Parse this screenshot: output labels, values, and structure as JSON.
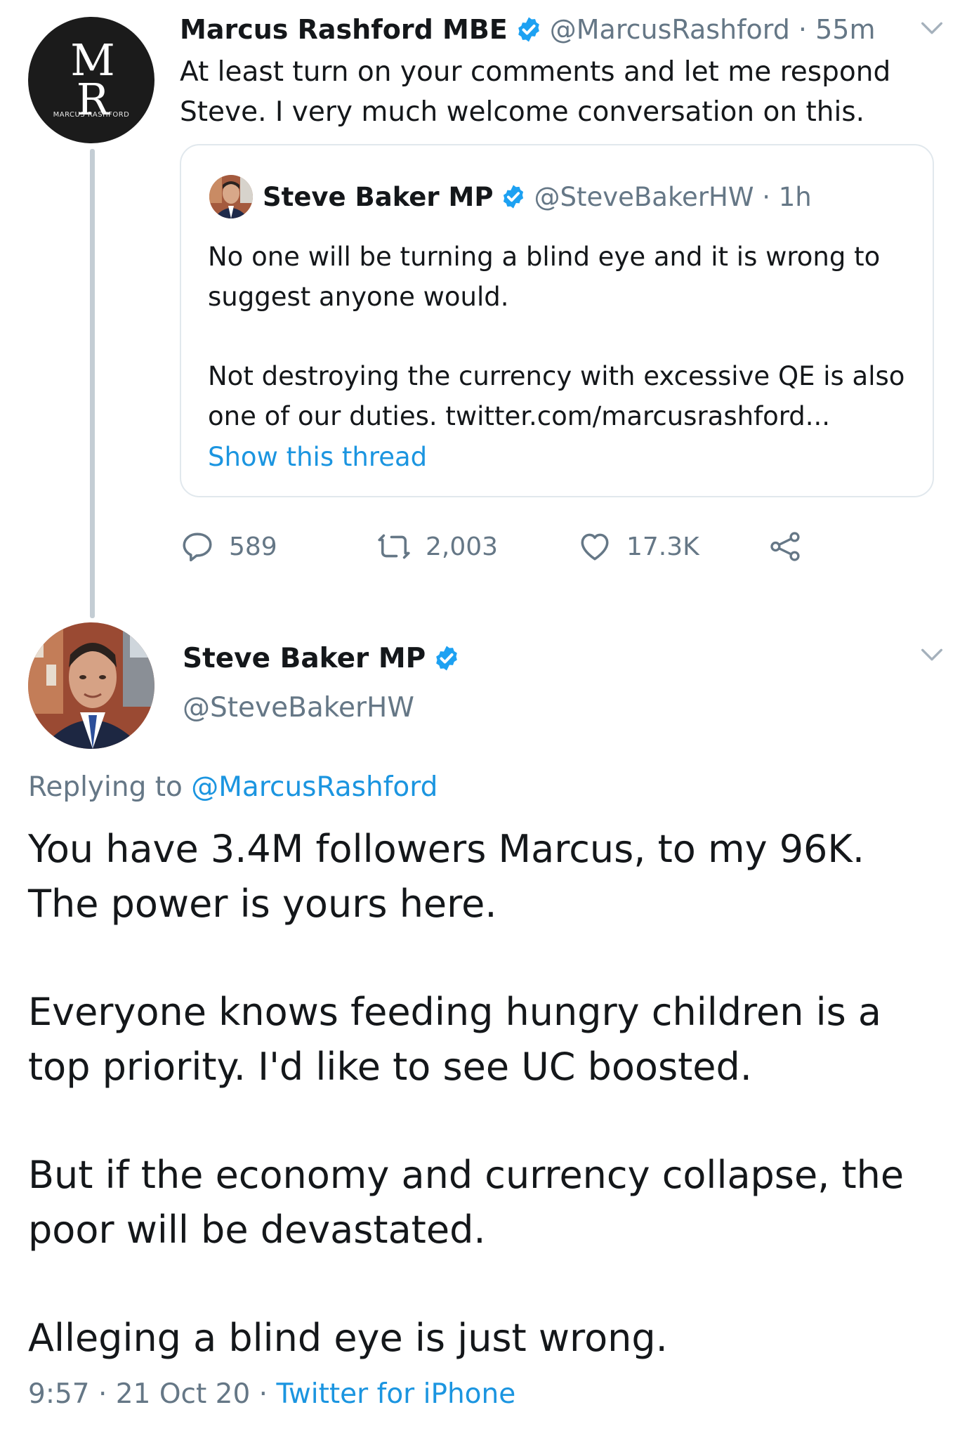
{
  "tweet1": {
    "avatar_monogram_top": "M",
    "avatar_monogram_bottom": "R",
    "avatar_caption": "MARCUS RASHFORD",
    "name": "Marcus Rashford MBE",
    "handle": "@MarcusRashford",
    "sep": "·",
    "time": "55m",
    "text": "At least turn on your comments and let me respond Steve. I very much welcome conversation on this.",
    "quote": {
      "name": "Steve Baker MP",
      "handle": "@SteveBakerHW",
      "sep": "·",
      "time": "1h",
      "para1": "No one will be turning a blind eye and it is wrong to suggest anyone would.",
      "para2": "Not destroying the currency with excessive QE is also one of our duties. twitter.com/marcusrashford...",
      "show_thread": "Show this thread"
    },
    "actions": {
      "replies": "589",
      "retweets": "2,003",
      "likes": "17.3K"
    }
  },
  "tweet2": {
    "name": "Steve Baker MP",
    "handle": "@SteveBakerHW",
    "replying_prefix": "Replying to ",
    "replying_to": "@MarcusRashford",
    "para1": "You have 3.4M followers Marcus, to my 96K. The power is yours here.",
    "para2": "Everyone knows feeding hungry children is a top priority. I'd like to see UC boosted.",
    "para3": "But if the economy and currency collapse, the poor will be devastated.",
    "para4": "Alleging a blind eye is just wrong.",
    "time": "9:57",
    "sep1": " · ",
    "date": "21 Oct 20",
    "sep2": " · ",
    "source": "Twitter for iPhone"
  },
  "icons": {
    "verified": "verified-badge",
    "chevron": "chevron-down",
    "reply": "speech-bubble",
    "retweet": "retweet-arrows",
    "like": "heart-outline",
    "share": "share-nodes"
  },
  "colors": {
    "text": "#14171a",
    "muted": "#657786",
    "link": "#1b95e0",
    "verified": "#1da1f2",
    "border": "#e1e8ed"
  }
}
